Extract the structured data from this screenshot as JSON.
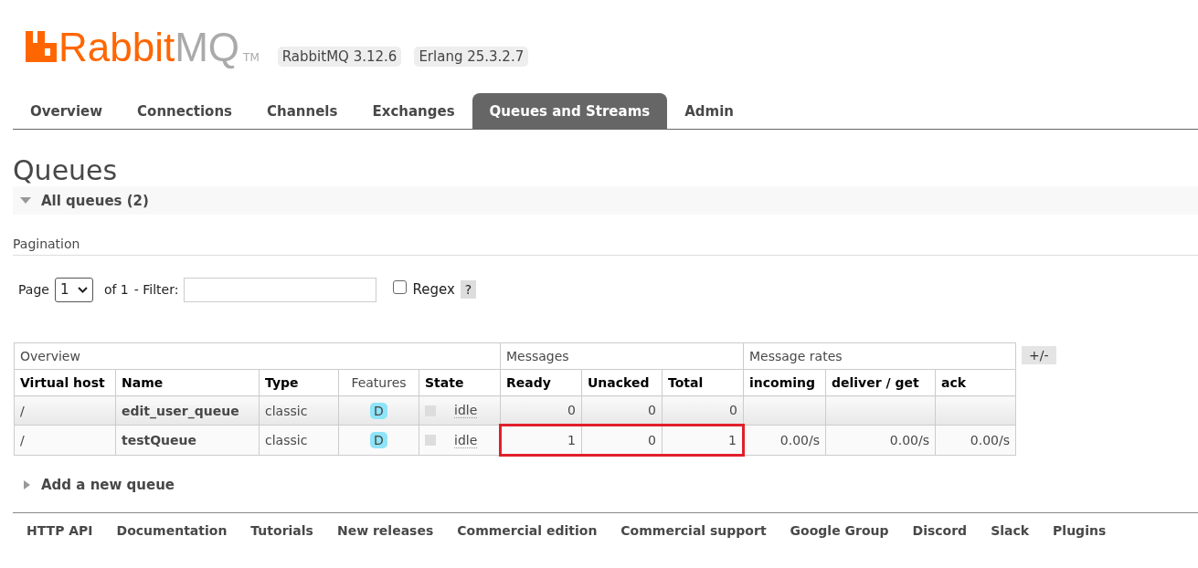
{
  "logo": {
    "brand": "Rabbit",
    "suffix": "MQ",
    "trademark": "TM"
  },
  "versions": [
    "RabbitMQ 3.12.6",
    "Erlang 25.3.2.7"
  ],
  "tabs": [
    {
      "label": "Overview",
      "selected": false
    },
    {
      "label": "Connections",
      "selected": false
    },
    {
      "label": "Channels",
      "selected": false
    },
    {
      "label": "Exchanges",
      "selected": false
    },
    {
      "label": "Queues and Streams",
      "selected": true
    },
    {
      "label": "Admin",
      "selected": false
    }
  ],
  "heading": "Queues",
  "section": {
    "label": "All queues (2)",
    "expanded": true
  },
  "pagination": {
    "label": "Pagination",
    "page_label": "Page",
    "page": "1",
    "of": "of 1",
    "filter_label": "- Filter:",
    "regex_checked": false,
    "regex_label": "Regex",
    "help": "?"
  },
  "table": {
    "groups": [
      "Overview",
      "Messages",
      "Message rates"
    ],
    "toggle": "+/-",
    "columns": [
      "Virtual host",
      "Name",
      "Type",
      "Features",
      "State",
      "Ready",
      "Unacked",
      "Total",
      "incoming",
      "deliver / get",
      "ack"
    ],
    "rows": [
      {
        "vhost": "/",
        "name": "edit_user_queue",
        "type": "classic",
        "feature": "D",
        "state": "idle",
        "ready": "0",
        "unacked": "0",
        "total": "0",
        "highlighted": false
      },
      {
        "vhost": "/",
        "name": "testQueue",
        "type": "classic",
        "feature": "D",
        "state": "idle",
        "ready": "1",
        "unacked": "0",
        "total": "1",
        "incoming": "0.00/s",
        "deliver_get": "0.00/s",
        "ack": "0.00/s",
        "highlighted": true
      }
    ]
  },
  "add_section": {
    "label": "Add a new queue",
    "expanded": false
  },
  "footer_links": [
    "HTTP API",
    "Documentation",
    "Tutorials",
    "New releases",
    "Commercial edition",
    "Commercial support",
    "Google Group",
    "Discord",
    "Slack",
    "Plugins"
  ]
}
